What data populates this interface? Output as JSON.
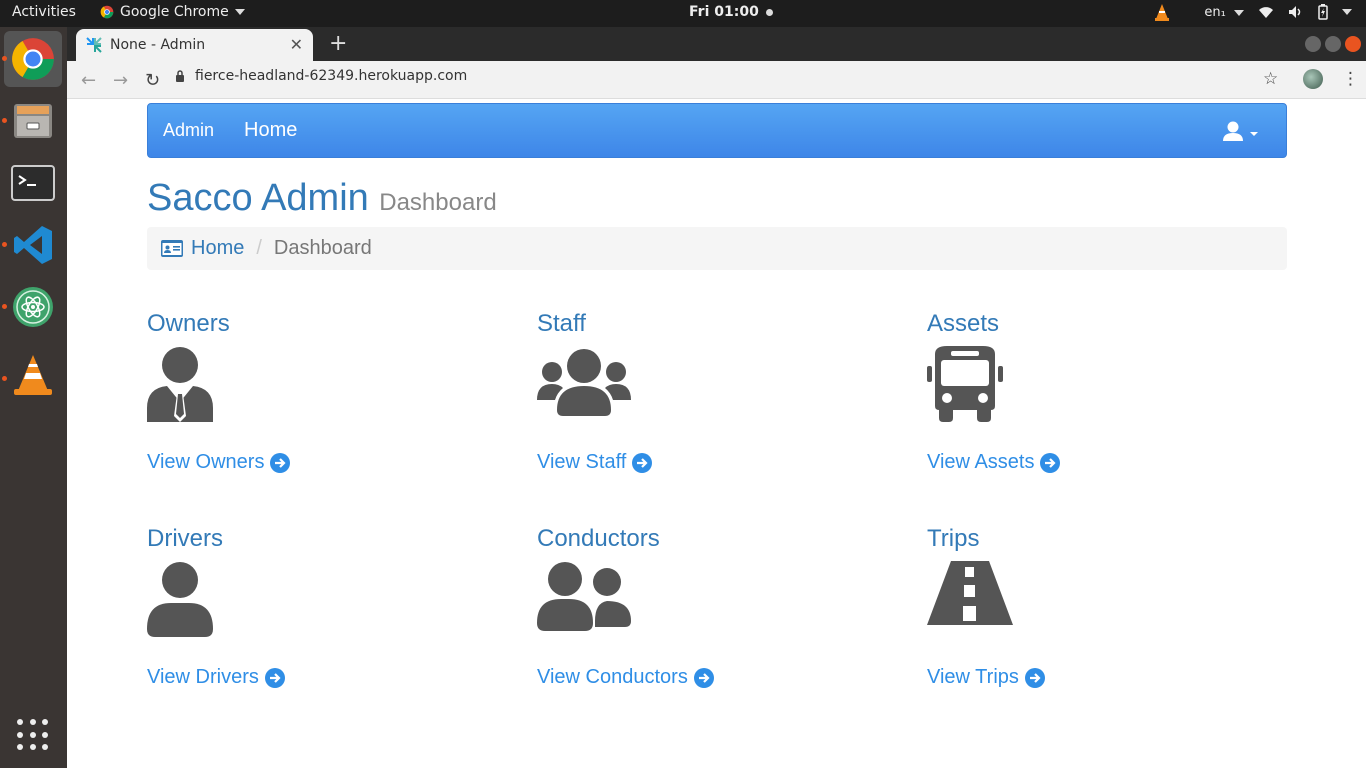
{
  "topbar": {
    "activities": "Activities",
    "app_name": "Google Chrome",
    "clock": "Fri 01:00",
    "keyboard": "en₁"
  },
  "browser": {
    "tab_title": "None - Admin",
    "url": "fierce-headland-62349.herokuapp.com"
  },
  "navbar": {
    "brand": "Admin",
    "home": "Home"
  },
  "header": {
    "title": "Sacco Admin",
    "subtitle": "Dashboard"
  },
  "breadcrumb": {
    "home": "Home",
    "current": "Dashboard"
  },
  "cards": [
    {
      "title": "Owners",
      "link": "View Owners",
      "icon": "user-tie-icon"
    },
    {
      "title": "Staff",
      "link": "View Staff",
      "icon": "users-icon"
    },
    {
      "title": "Assets",
      "link": "View Assets",
      "icon": "bus-icon"
    },
    {
      "title": "Drivers",
      "link": "View Drivers",
      "icon": "user-icon"
    },
    {
      "title": "Conductors",
      "link": "View Conductors",
      "icon": "user-friends-icon"
    },
    {
      "title": "Trips",
      "link": "View Trips",
      "icon": "road-icon"
    }
  ],
  "colors": {
    "primary": "#337ab7",
    "link": "#2f8ee6",
    "navbar": "#3e86e8",
    "icon": "#555555"
  }
}
